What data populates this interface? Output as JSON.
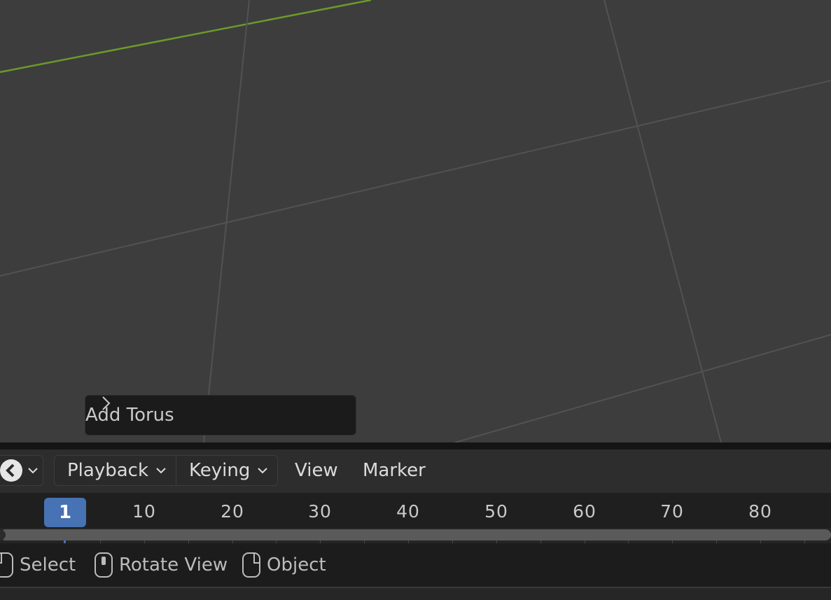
{
  "viewport": {
    "grid_color": "#525252",
    "axis_color": "#6b9a2a"
  },
  "redo_panel": {
    "label": "Add Torus"
  },
  "timeline_header": {
    "menus": {
      "playback": "Playback",
      "keying": "Keying",
      "view": "View",
      "marker": "Marker"
    }
  },
  "ruler": {
    "current_frame": "1",
    "labels": [
      "10",
      "20",
      "30",
      "40",
      "50",
      "60",
      "70",
      "80"
    ]
  },
  "statusbar": {
    "left_mouse": "Select",
    "middle_mouse": "Rotate View",
    "right_mouse": "Object"
  },
  "colors": {
    "accent": "#4772b3"
  }
}
